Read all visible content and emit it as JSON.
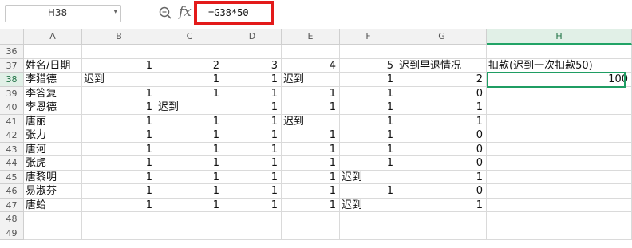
{
  "name_box": {
    "value": "H38",
    "dropdown_icon": "caret-down-icon"
  },
  "toolbar": {
    "zoom_icon": "magnifier-icon",
    "fx_label": "fx"
  },
  "formula_bar": {
    "value": "=G38*50"
  },
  "columns": [
    "A",
    "B",
    "C",
    "D",
    "E",
    "F",
    "G",
    "H"
  ],
  "active_column": "H",
  "active_row": "38",
  "rows": [
    {
      "num": "36",
      "cells": [
        "",
        "",
        "",
        "",
        "",
        "",
        "",
        ""
      ]
    },
    {
      "num": "37",
      "cells": [
        "姓名/日期",
        "1",
        "2",
        "3",
        "4",
        "5",
        "迟到早退情况",
        "扣款(迟到一次扣款50)"
      ]
    },
    {
      "num": "38",
      "cells": [
        "李猎德",
        "迟到",
        "1",
        "1",
        "迟到",
        "1",
        "2",
        "100"
      ]
    },
    {
      "num": "39",
      "cells": [
        "李答复",
        "1",
        "1",
        "1",
        "1",
        "1",
        "0",
        ""
      ]
    },
    {
      "num": "40",
      "cells": [
        "李恩德",
        "1",
        "迟到",
        "1",
        "1",
        "1",
        "1",
        ""
      ]
    },
    {
      "num": "41",
      "cells": [
        "唐丽",
        "1",
        "1",
        "1",
        "迟到",
        "1",
        "1",
        ""
      ]
    },
    {
      "num": "42",
      "cells": [
        "张力",
        "1",
        "1",
        "1",
        "1",
        "1",
        "0",
        ""
      ]
    },
    {
      "num": "43",
      "cells": [
        "唐河",
        "1",
        "1",
        "1",
        "1",
        "1",
        "0",
        ""
      ]
    },
    {
      "num": "44",
      "cells": [
        "张虎",
        "1",
        "1",
        "1",
        "1",
        "1",
        "0",
        ""
      ]
    },
    {
      "num": "45",
      "cells": [
        "唐黎明",
        "1",
        "1",
        "1",
        "1",
        "迟到",
        "1",
        ""
      ]
    },
    {
      "num": "46",
      "cells": [
        "易淑芬",
        "1",
        "1",
        "1",
        "1",
        "1",
        "0",
        ""
      ]
    },
    {
      "num": "47",
      "cells": [
        "唐蛤",
        "1",
        "1",
        "1",
        "1",
        "迟到",
        "1",
        ""
      ]
    },
    {
      "num": "48",
      "cells": [
        "",
        "",
        "",
        "",
        "",
        "",
        "",
        ""
      ]
    },
    {
      "num": "49",
      "cells": [
        "",
        "",
        "",
        "",
        "",
        "",
        "",
        ""
      ]
    }
  ]
}
